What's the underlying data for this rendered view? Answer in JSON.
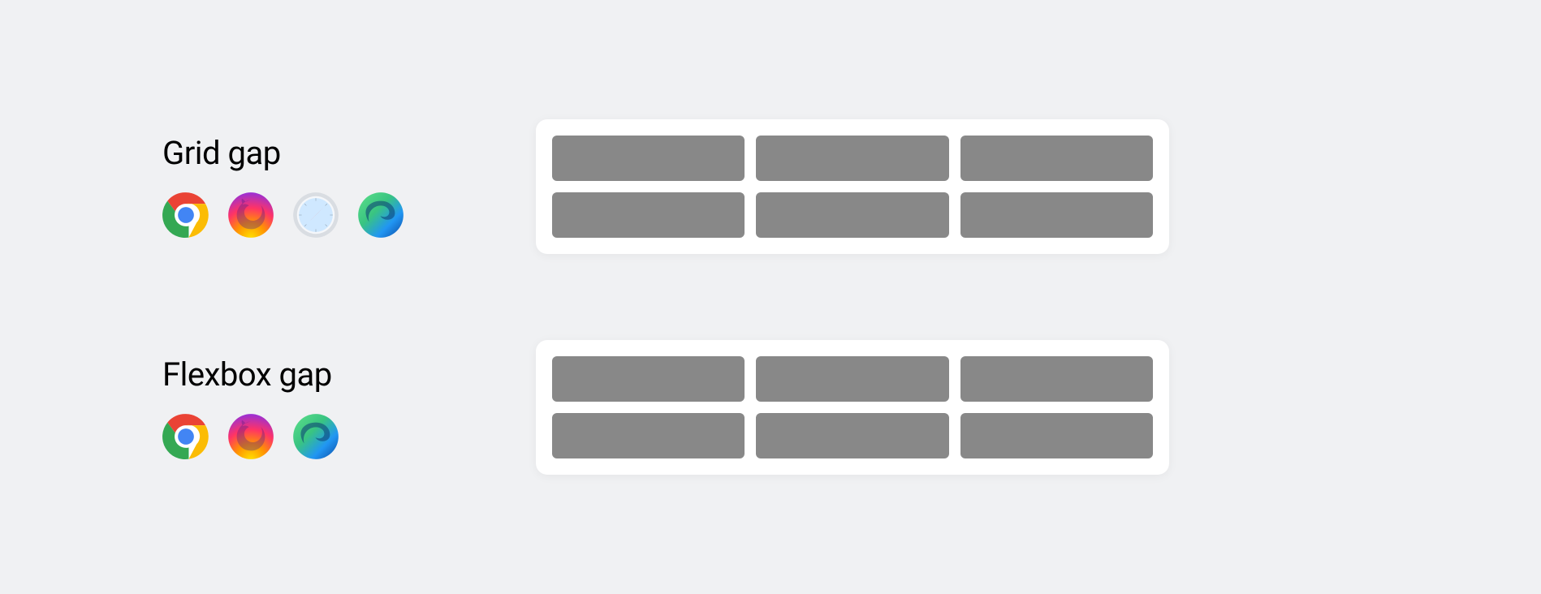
{
  "sections": [
    {
      "title": "Grid gap",
      "browsers": [
        "chrome",
        "firefox",
        "safari",
        "edge"
      ]
    },
    {
      "title": "Flexbox gap",
      "browsers": [
        "chrome",
        "firefox",
        "edge"
      ]
    }
  ],
  "grid": {
    "rows": 2,
    "cols": 3
  },
  "colors": {
    "cell": "#888888",
    "card": "#ffffff",
    "background": "#f0f1f3"
  }
}
